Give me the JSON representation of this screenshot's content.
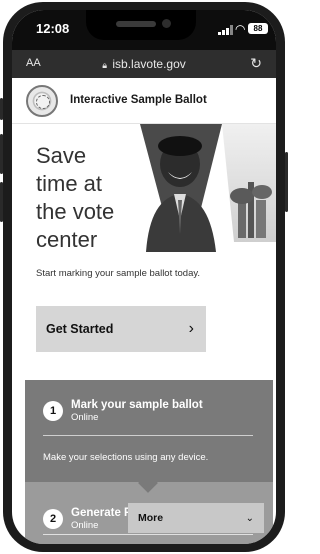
{
  "status_bar": {
    "time": "12:08",
    "battery": "88",
    "icons": [
      "signal-icon",
      "wifi-icon",
      "battery-icon"
    ]
  },
  "url_bar": {
    "text_size_label": "AA",
    "url": "isb.lavote.gov",
    "icons": [
      "lock-icon",
      "reload-icon"
    ]
  },
  "header": {
    "title": "Interactive Sample Ballot",
    "logo": "county-seal"
  },
  "hero": {
    "lines": [
      "Save",
      "time at",
      "the vote",
      "center"
    ],
    "subtitle": "Start marking your sample ballot today."
  },
  "cta": {
    "label": "Get Started",
    "icon": "chevron-right-icon"
  },
  "steps": [
    {
      "number": "1",
      "title": "Mark your sample ballot",
      "subtitle": "Online",
      "description": "Make your selections using any device."
    },
    {
      "number": "2",
      "title": "Generate Poll Pass",
      "subtitle": "Online"
    }
  ],
  "more": {
    "label": "More",
    "icon": "chevron-down-icon"
  },
  "colors": {
    "panel": "#7a7a7a",
    "panel_alt": "#9b9b9b",
    "button": "#d6d6d6",
    "browser_bar": "#2e2e2e"
  }
}
